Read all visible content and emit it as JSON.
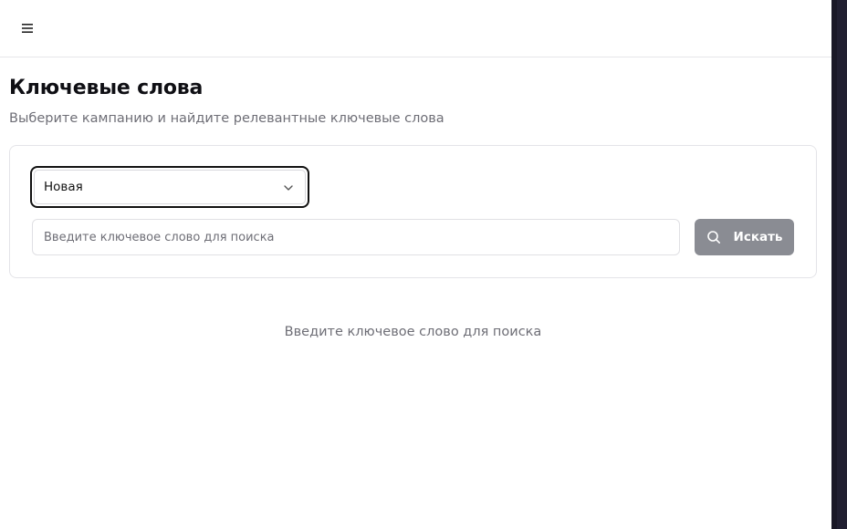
{
  "header": {
    "menu_icon": "hamburger-menu-icon"
  },
  "page": {
    "title": "Ключевые слова",
    "subtitle": "Выберите кампанию и найдите релевантные ключевые слова"
  },
  "filters": {
    "campaign_select": {
      "value": "Новая",
      "icon": "chevron-down-icon"
    },
    "search": {
      "value": "",
      "placeholder": "Введите ключевое слово для поиска"
    },
    "search_button": {
      "label": "Искать",
      "icon": "search-icon"
    }
  },
  "results": {
    "empty_message": "Введите ключевое слово для поиска"
  },
  "colors": {
    "button_bg": "#8a8c93",
    "subtitle_text": "#6e6e76",
    "border": "#e4e4e8",
    "side_edge": "#211f31"
  }
}
